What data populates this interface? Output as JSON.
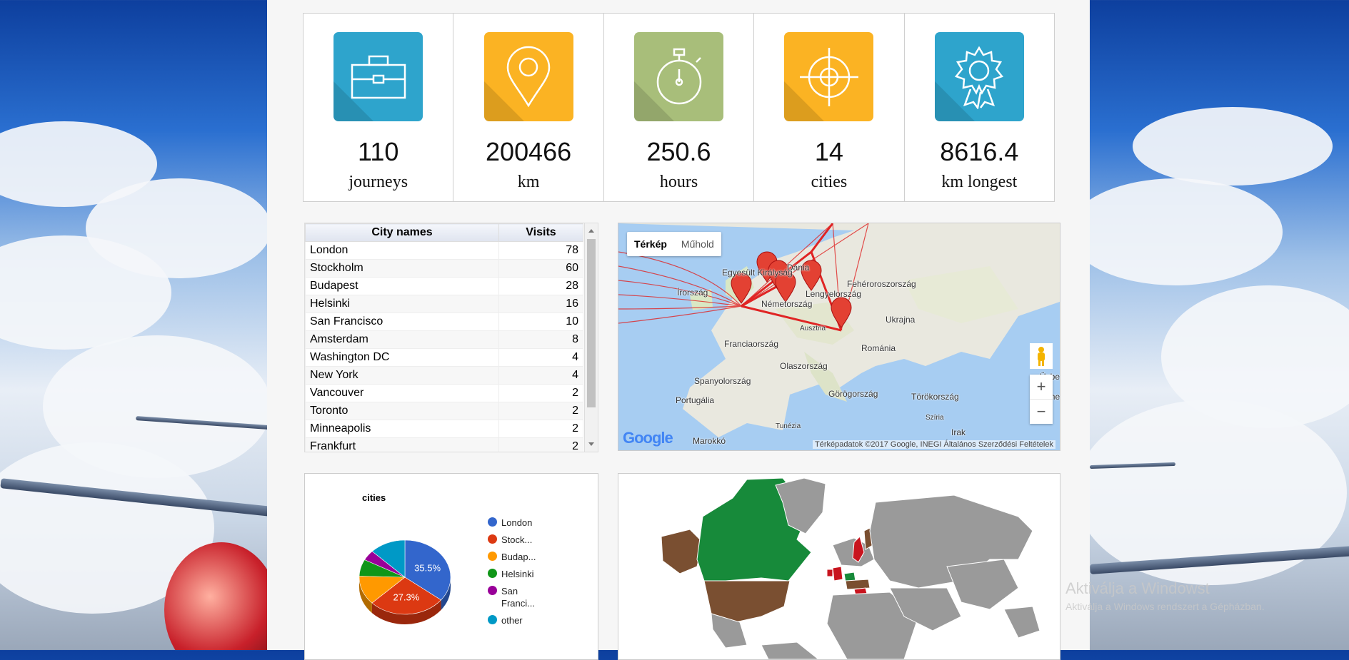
{
  "stats": [
    {
      "value": "110",
      "label": "journeys",
      "icon": "briefcase-icon",
      "color": "#2ea4cc"
    },
    {
      "value": "200466",
      "label": "km",
      "icon": "map-pin-icon",
      "color": "#fbb323"
    },
    {
      "value": "250.6",
      "label": "hours",
      "icon": "stopwatch-icon",
      "color": "#a8be7a"
    },
    {
      "value": "14",
      "label": "cities",
      "icon": "crosshair-icon",
      "color": "#fbb323"
    },
    {
      "value": "8616.4",
      "label": "km longest",
      "icon": "award-ribbon-icon",
      "color": "#2ea4cc"
    }
  ],
  "city_table": {
    "headers": [
      "City names",
      "Visits"
    ],
    "rows": [
      [
        "London",
        "78"
      ],
      [
        "Stockholm",
        "60"
      ],
      [
        "Budapest",
        "28"
      ],
      [
        "Helsinki",
        "16"
      ],
      [
        "San Francisco",
        "10"
      ],
      [
        "Amsterdam",
        "8"
      ],
      [
        "Washington DC",
        "4"
      ],
      [
        "New York",
        "4"
      ],
      [
        "Vancouver",
        "2"
      ],
      [
        "Toronto",
        "2"
      ],
      [
        "Minneapolis",
        "2"
      ],
      [
        "Frankfurt",
        "2"
      ]
    ]
  },
  "map": {
    "type_buttons": [
      "Térkép",
      "Műhold"
    ],
    "countries": [
      "Egyesült Királyság",
      "Dánia",
      "Írország",
      "Németország",
      "Lengyelország",
      "Fehéroroszország",
      "Ukrajna",
      "Ausztria",
      "Franciaország",
      "Románia",
      "Olaszország",
      "Spanyolország",
      "Portugália",
      "Görögország",
      "Törökország",
      "Szíria",
      "Irak",
      "Tunézia",
      "Marokkó",
      "Üzbe",
      "Turkmen"
    ],
    "logo": "Google",
    "footer": "Térképadatok ©2017 Google, INEGI   Általános Szerződési Feltételek"
  },
  "pie": {
    "title": "cities",
    "legend": [
      {
        "label": "London",
        "color": "#3366cc"
      },
      {
        "label": "Stock...",
        "color": "#dc3912"
      },
      {
        "label": "Budap...",
        "color": "#ff9900"
      },
      {
        "label": "Helsinki",
        "color": "#109618"
      },
      {
        "label": "San Franci...",
        "color": "#990099"
      },
      {
        "label": "other",
        "color": "#0099c6"
      }
    ],
    "slice_labels": [
      "35.5%",
      "27.3%"
    ]
  },
  "chart_data": {
    "type": "pie",
    "title": "cities",
    "categories": [
      "London",
      "Stock...",
      "Budap...",
      "Helsinki",
      "San Franci...",
      "other"
    ],
    "values": [
      35.5,
      27.3,
      12.7,
      7.3,
      4.5,
      12.7
    ]
  },
  "watermark": {
    "line1": "Aktiválja a Windowst",
    "line2": "Aktiválja a Windows rendszert a Gépházban."
  }
}
